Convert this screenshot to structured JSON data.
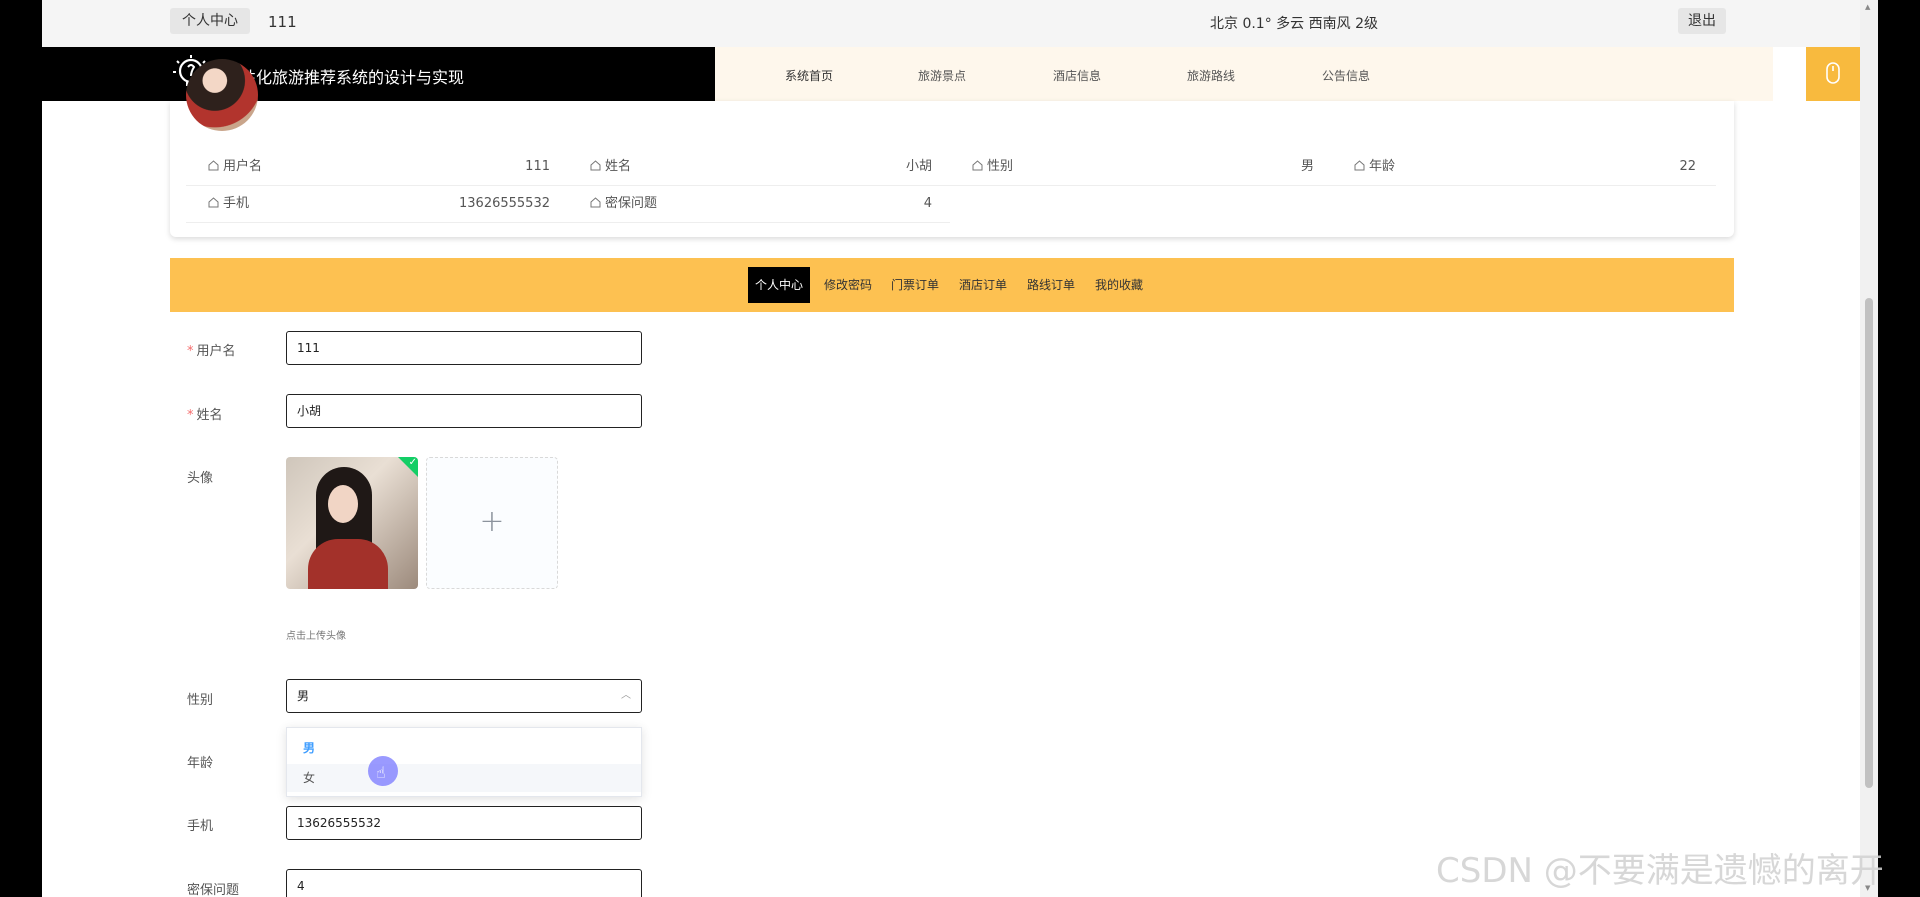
{
  "topbar": {
    "user_center": "个人中心",
    "username": "111",
    "weather": "北京  0.1°  多云  西南风  2级",
    "logout": "退出"
  },
  "header": {
    "title": "个性化旅游推荐系统的设计与实现",
    "nav": [
      "系统首页",
      "旅游景点",
      "酒店信息",
      "旅游路线",
      "公告信息"
    ]
  },
  "profile": {
    "rows": [
      [
        {
          "label": "用户名",
          "value": "111"
        },
        {
          "label": "姓名",
          "value": "小胡"
        },
        {
          "label": "性别",
          "value": "男"
        },
        {
          "label": "年龄",
          "value": "22"
        }
      ],
      [
        {
          "label": "手机",
          "value": "13626555532"
        },
        {
          "label": "密保问题",
          "value": "4"
        }
      ]
    ]
  },
  "tabs": [
    "个人中心",
    "修改密码",
    "门票订单",
    "酒店订单",
    "路线订单",
    "我的收藏"
  ],
  "form": {
    "username_label": "用户名",
    "username_value": "111",
    "name_label": "姓名",
    "name_value": "小胡",
    "avatar_label": "头像",
    "upload_tip": "点击上传头像",
    "upload_plus": "+",
    "gender_label": "性别",
    "gender_value": "男",
    "gender_options": [
      "男",
      "女"
    ],
    "age_label": "年龄",
    "phone_label": "手机",
    "phone_value": "13626555532",
    "security_label": "密保问题",
    "security_value": "4",
    "required_mark": "*"
  },
  "watermark": "CSDN @不要满是遗憾的离开",
  "colors": {
    "brand_bg": "#000000",
    "nav_bg": "#fef7ec",
    "accent": "#fdc151",
    "nav_button": "#f8ba3e",
    "selected_option": "#409eff"
  },
  "icons": {
    "brand": "lightbulb-icon",
    "nav_button": "mouse-icon",
    "info": "home-icon",
    "select": "chevron-up-icon",
    "upload_check": "check-icon"
  }
}
